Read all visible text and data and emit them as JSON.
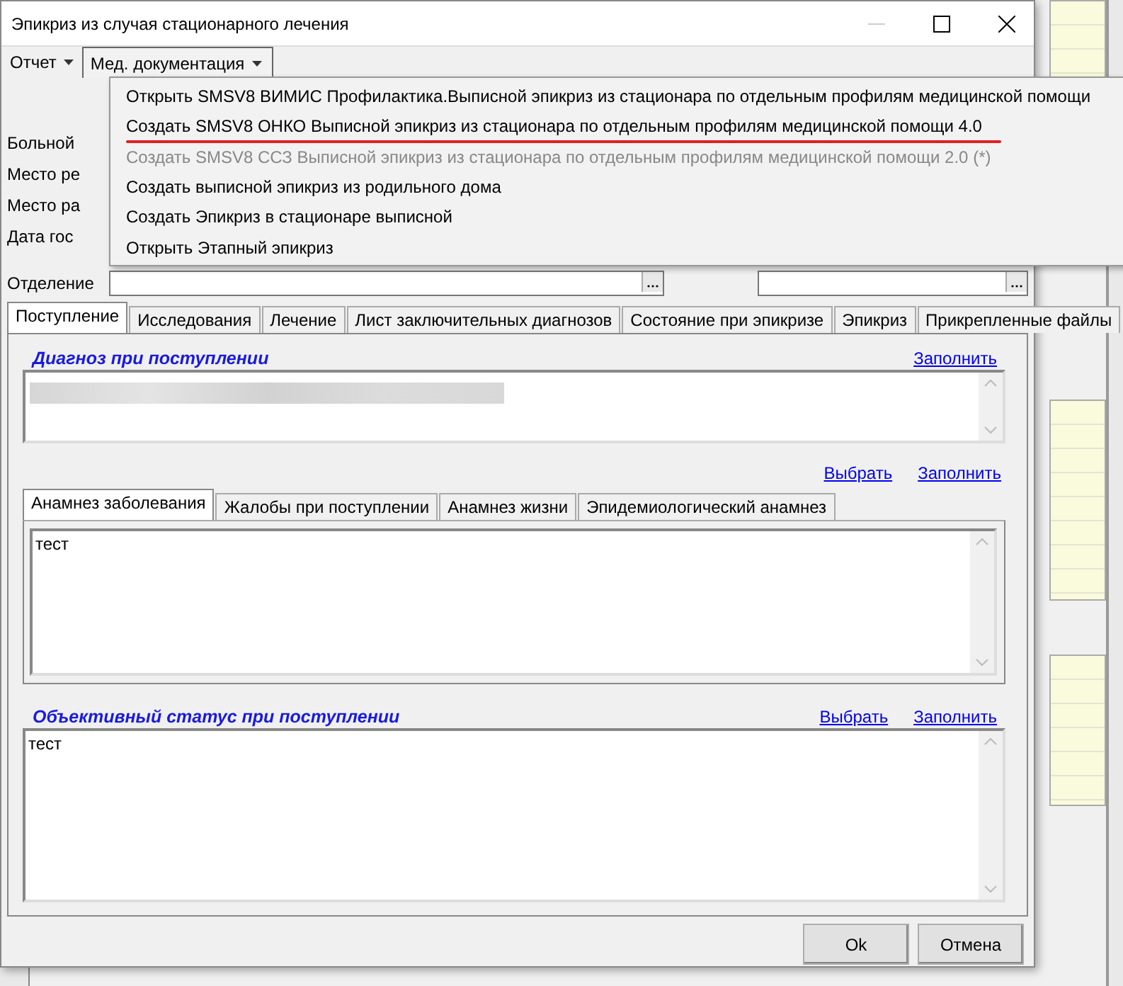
{
  "window": {
    "title": "Эпикриз из случая стационарного лечения"
  },
  "menubar": [
    {
      "label": "Отчет",
      "open": false
    },
    {
      "label": "Мед. документация",
      "open": true
    }
  ],
  "dropdown": {
    "items": [
      {
        "label": "Открыть SMSV8 ВИМИС Профилактика.Выписной эпикриз из стационара по отдельным профилям медицинской помощи",
        "disabled": false,
        "marked": false
      },
      {
        "label": "Создать SMSV8 ОНКО Выписной эпикриз из стационара по отдельным профилям медицинской помощи 4.0",
        "disabled": false,
        "marked": true
      },
      {
        "label": "Создать SMSV8 ССЗ Выписной эпикриз из стационара по отдельным профилям медицинской помощи 2.0 (*)",
        "disabled": true,
        "marked": false
      },
      {
        "label": "Создать выписной эпикриз из родильного дома",
        "disabled": false,
        "marked": false
      },
      {
        "label": "Создать Эпикриз в стационаре выписной",
        "disabled": false,
        "marked": false
      },
      {
        "label": "Открыть Этапный эпикриз",
        "disabled": false,
        "marked": false
      }
    ]
  },
  "form": {
    "partial_labels": [
      "Больной",
      "Место ре",
      "Место ра",
      "Дата гос"
    ],
    "department_label": "Отделение"
  },
  "tabs": [
    {
      "label": "Поступление",
      "selected": true
    },
    {
      "label": "Исследования",
      "selected": false
    },
    {
      "label": "Лечение",
      "selected": false
    },
    {
      "label": "Лист заключительных диагнозов",
      "selected": false
    },
    {
      "label": "Состояние при эпикризе",
      "selected": false
    },
    {
      "label": "Эпикриз",
      "selected": false
    },
    {
      "label": "Прикрепленные файлы",
      "selected": false
    }
  ],
  "diagnosis": {
    "title": "Диагноз при поступлении",
    "links": [
      "Заполнить"
    ]
  },
  "anamnesis": {
    "links": [
      "Выбрать",
      "Заполнить"
    ],
    "tabs": [
      {
        "label": "Анамнез заболевания",
        "selected": true
      },
      {
        "label": "Жалобы при поступлении",
        "selected": false
      },
      {
        "label": "Анамнез жизни",
        "selected": false
      },
      {
        "label": "Эпидемиологический анамнез",
        "selected": false
      }
    ],
    "text": "тест"
  },
  "objective": {
    "title": "Объективный статус при поступлении",
    "links": [
      "Выбрать",
      "Заполнить"
    ],
    "text": "тест"
  },
  "buttons": [
    "Ok",
    "Отмена"
  ]
}
